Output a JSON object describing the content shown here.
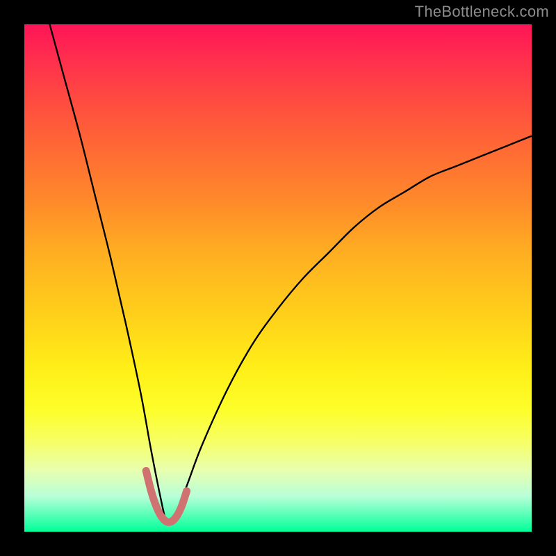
{
  "watermark": "TheBottleneck.com",
  "colors": {
    "background": "#000000",
    "watermark_text": "#8b8b8b",
    "curve_stroke": "#000000",
    "valley_stroke": "#d17272",
    "gradient_top": "#ff1558",
    "gradient_bottom": "#00ff98"
  },
  "chart_data": {
    "type": "line",
    "title": "",
    "xlabel": "",
    "ylabel": "",
    "xlim": [
      0,
      100
    ],
    "ylim": [
      0,
      100
    ],
    "notes": "Bottleneck-style V-curve. Y is approximate bottleneck percentage (0 at valley, ~100 at top). X is component balance position (arbitrary 0–100). Valley near x≈28. Right branch asymptotes ~78 at x=100.",
    "series": [
      {
        "name": "bottleneck-curve",
        "x": [
          5,
          8,
          11,
          14,
          17,
          20,
          23,
          25,
          27,
          28,
          29,
          30,
          32,
          35,
          40,
          45,
          50,
          55,
          60,
          65,
          70,
          75,
          80,
          85,
          90,
          95,
          100
        ],
        "values": [
          100,
          89,
          78,
          66,
          54,
          41,
          27,
          16,
          6,
          2,
          2,
          4,
          9,
          17,
          28,
          37,
          44,
          50,
          55,
          60,
          64,
          67,
          70,
          72,
          74,
          76,
          78
        ]
      },
      {
        "name": "valley-highlight",
        "x": [
          24,
          25,
          26,
          27,
          28,
          29,
          30,
          31,
          32
        ],
        "values": [
          12,
          8,
          5,
          3,
          2,
          2,
          3,
          5,
          8
        ]
      }
    ]
  }
}
